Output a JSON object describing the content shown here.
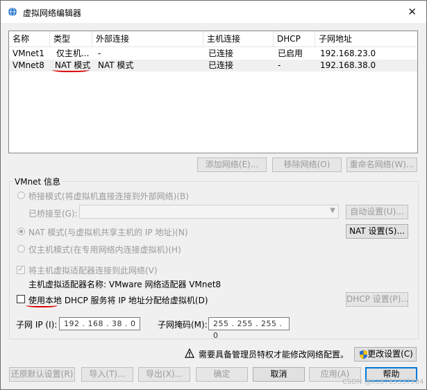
{
  "window": {
    "title": "虚拟网络编辑器",
    "close_glyph": "✕"
  },
  "table": {
    "columns": [
      "名称",
      "类型",
      "外部连接",
      "主机连接",
      "DHCP",
      "子网地址"
    ],
    "rows": [
      [
        "VMnet1",
        "仅主机...",
        "-",
        "已连接",
        "已启用",
        "192.168.23.0"
      ],
      [
        "VMnet8",
        "NAT 模式",
        "NAT 模式",
        "已连接",
        "-",
        "192.168.38.0"
      ]
    ],
    "selected_row": 1
  },
  "list_buttons": {
    "add": "添加网络(E)...",
    "remove": "移除网络(O)",
    "rename": "重命名网络(W)..."
  },
  "vmnet_info": {
    "label": "VMnet 信息",
    "bridge_radio": "桥接模式(将虚拟机直接连接到外部网络)(B)",
    "bridged_to_label": "已桥接至(G):",
    "bridged_to_value": "",
    "auto_settings": "自动设置(U)...",
    "nat_radio": "NAT 模式(与虚拟机共享主机的 IP 地址)(N)",
    "nat_settings": "NAT 设置(S)...",
    "hostonly_radio": "仅主机模式(在专用网络内连接虚拟机)(H)",
    "connect_adapter_check": "将主机虚拟适配器连接到此网络(V)",
    "connect_adapter_checked": true,
    "adapter_name_label": "主机虚拟适配器名称: VMware 网络适配器 VMnet8",
    "dhcp_check": "使用本地 DHCP 服务将 IP 地址分配给虚拟机(D)",
    "dhcp_checked": false,
    "dhcp_settings": "DHCP 设置(P)...",
    "subnet_ip_label": "子网 IP (I):",
    "subnet_ip_value": "192 . 168 . 38 . 0",
    "subnet_mask_label": "子网掩码(M):",
    "subnet_mask_value": "255 . 255 . 255 . 0"
  },
  "admin_notice": {
    "text": "需要具备管理员特权才能修改网络配置。",
    "change_settings": "更改设置(C)"
  },
  "footer_buttons": {
    "restore": "还原默认设置(R)",
    "import": "导入(T)...",
    "export": "导出(X)...",
    "ok": "确定",
    "cancel": "取消",
    "apply": "应用(A)",
    "help": "帮助"
  },
  "watermark": "CSDN @k18783337584",
  "colors": {
    "accent": "#0078d7",
    "annotation_red": "#dd0000"
  }
}
